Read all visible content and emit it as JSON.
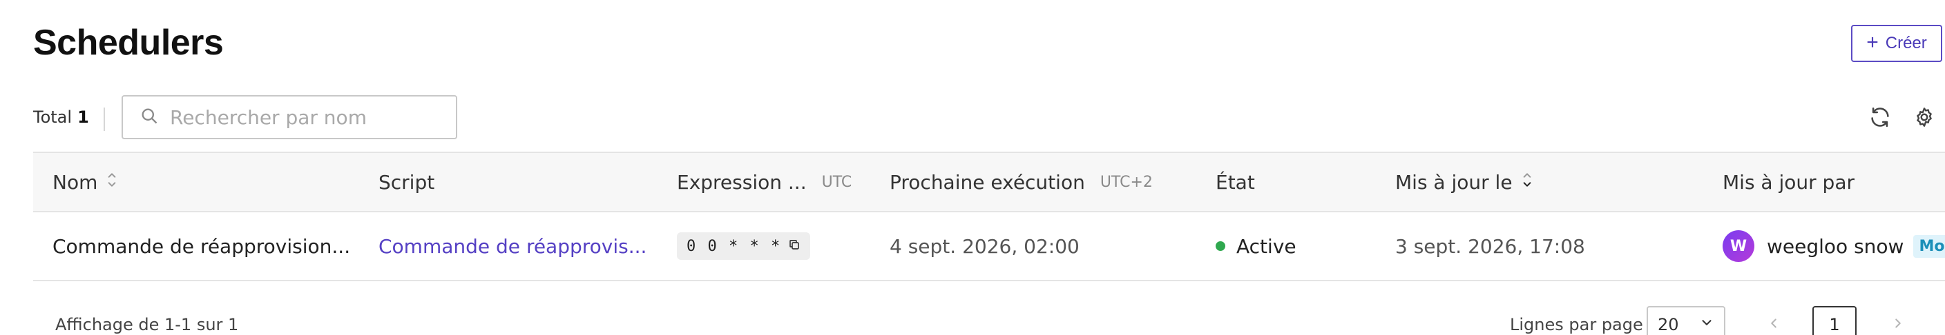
{
  "header": {
    "title": "Schedulers",
    "create_label": "Créer"
  },
  "toolbar": {
    "total_label": "Total",
    "total_count": "1",
    "search_placeholder": "Rechercher par nom"
  },
  "icons": {
    "search": "search-icon",
    "refresh": "refresh-icon",
    "settings": "gear-icon",
    "sort": "sort-icon",
    "copy": "copy-icon",
    "prev": "chevron-left-icon",
    "next": "chevron-right-icon",
    "dropdown": "chevron-down-icon"
  },
  "table": {
    "columns": {
      "name": "Nom",
      "script": "Script",
      "expression": "Expression ...",
      "expression_tz": "UTC",
      "next_run": "Prochaine exécution",
      "next_run_tz": "UTC+2",
      "state": "État",
      "updated_at": "Mis à jour le",
      "updated_by": "Mis à jour par"
    },
    "rows": [
      {
        "name": "Commande de réapprovision...",
        "script": "Commande de réapprovis...",
        "expression": "0 0 * * *",
        "next_run": "4 sept. 2026, 02:00",
        "state": "Active",
        "updated_at": "3 sept. 2026, 17:08",
        "avatar_letter": "W",
        "updated_by": "weegloo snow",
        "me_badge": "Moi"
      }
    ]
  },
  "footer": {
    "range_text": "Affichage de 1-1 sur 1",
    "rows_per_page_label": "Lignes par page",
    "rows_per_page_value": "20",
    "current_page": "1"
  },
  "colors": {
    "accent": "#5540c4",
    "status_active": "#2fa84f",
    "badge_bg": "#dff3fb",
    "badge_text": "#1b8fb8"
  }
}
